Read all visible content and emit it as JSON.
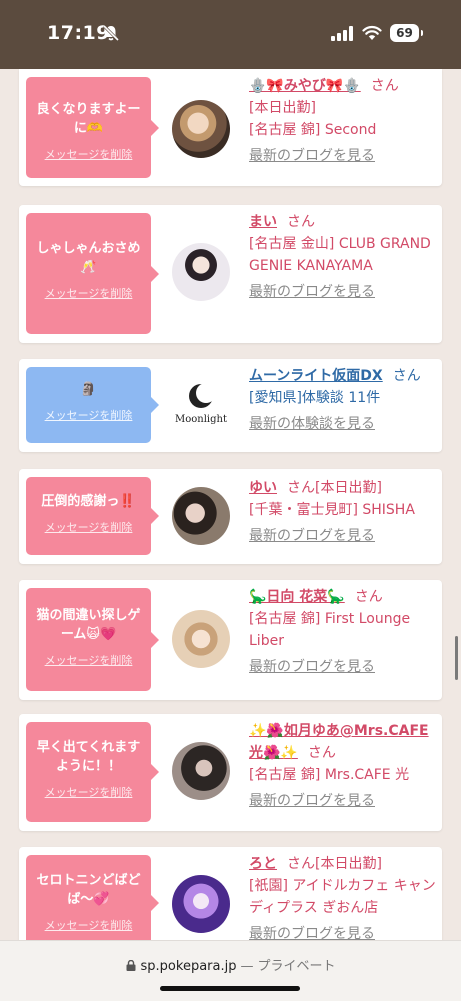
{
  "status_bar": {
    "time": "17:19",
    "battery": "69"
  },
  "cards": [
    {
      "message": "良くなりますよーに🫶",
      "delete_label": "メッセージを削除",
      "name": "🪬🎀みやび🎀🪬",
      "san": "さん",
      "details": [
        "[本日出勤]",
        "[名古屋 錦] Second"
      ],
      "link": "最新のブログを見る"
    },
    {
      "message": "しゃしゃんおさめ🥂",
      "delete_label": "メッセージを削除",
      "name": "まい",
      "san": "さん",
      "details": [
        "[名古屋 金山] CLUB GRAND GENIE KANAYAMA"
      ],
      "link": "最新のブログを見る"
    },
    {
      "message": "🗿",
      "delete_label": "メッセージを削除",
      "name": "ムーンライト仮面DX",
      "san": "さん",
      "details": [
        "[愛知県]体験談 11件"
      ],
      "link": "最新の体験談を見る",
      "logo_text": "Moonlight"
    },
    {
      "message": "圧倒的感謝っ‼️",
      "delete_label": "メッセージを削除",
      "name": "ゆい",
      "san": "さん",
      "status": "[本日出勤]",
      "details": [
        "[千葉・富士見町] SHISHA"
      ],
      "link": "最新のブログを見る"
    },
    {
      "message": "猫の間違い探しゲーム🙀💗",
      "delete_label": "メッセージを削除",
      "name": "🦕日向 花菜🦕",
      "san": "さん",
      "details": [
        "[名古屋 錦] First Lounge Liber"
      ],
      "link": "最新のブログを見る"
    },
    {
      "message": "早く出てくれますように！！",
      "delete_label": "メッセージを削除",
      "name": "✨🌺如月ゆあ@Mrs.CAFE光🌺✨",
      "san": "さん",
      "details": [
        "[名古屋 錦] Mrs.CAFE 光"
      ],
      "link": "最新のブログを見る"
    },
    {
      "message": "セロトニンどばどば〜💞",
      "delete_label": "メッセージを削除",
      "name": "ろと",
      "san": "さん",
      "status": "[本日出勤]",
      "details": [
        "[祇園] アイドルカフェ キャンディプラス ぎおん店"
      ],
      "link": "最新のブログを見る"
    }
  ],
  "browser": {
    "url": "sp.pokepara.jp",
    "separator": "—",
    "mode": "プライベート"
  },
  "colors": {
    "header": "#5b4b3e",
    "pink": "#f5889b",
    "blue_bubble": "#8db8f2",
    "name_pink": "#d24a67",
    "name_blue": "#2f6aa6"
  }
}
